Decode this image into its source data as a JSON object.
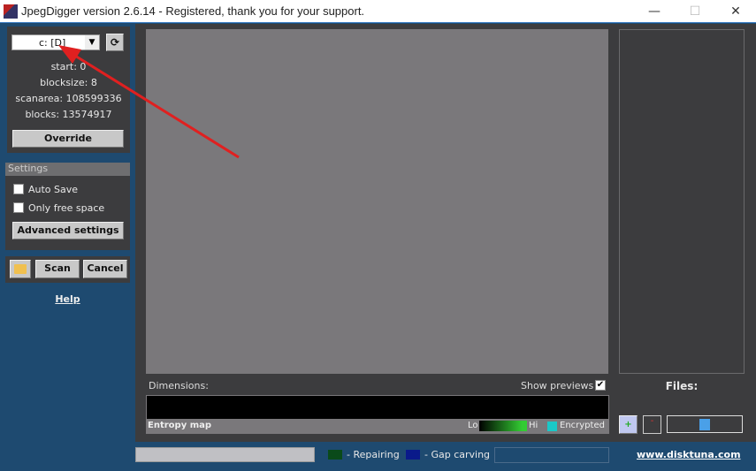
{
  "window": {
    "title": "JpegDigger version 2.6.14 - Registered, thank you for your support."
  },
  "drive": {
    "selected": "c: [D]"
  },
  "info": {
    "start": "start: 0",
    "blocksize": "blocksize: 8",
    "scanarea": "scanarea: 108599336",
    "blocks": "blocks: 13574917"
  },
  "buttons": {
    "override": "Override",
    "advanced": "Advanced settings",
    "scan": "Scan",
    "cancel": "Cancel"
  },
  "settings": {
    "header": "Settings",
    "auto_save": "Auto Save",
    "auto_save_checked": false,
    "only_free": "Only free space",
    "only_free_checked": false
  },
  "help": "Help",
  "main": {
    "dimensions": "Dimensions:",
    "show_previews": "Show previews",
    "show_previews_checked": true,
    "entropy_map": "Entropy map",
    "lo": "Lo",
    "hi": "Hi",
    "encrypted": "Encrypted"
  },
  "files": {
    "label": "Files:"
  },
  "status": {
    "repairing": "- Repairing",
    "gap_carving": "- Gap carving",
    "link": "www.disktuna.com"
  },
  "colors": {
    "repairing": "#0a4a1a",
    "gap_carving": "#0a1a8a",
    "encrypted": "#1ac8c8",
    "arrow": "#e02020"
  }
}
